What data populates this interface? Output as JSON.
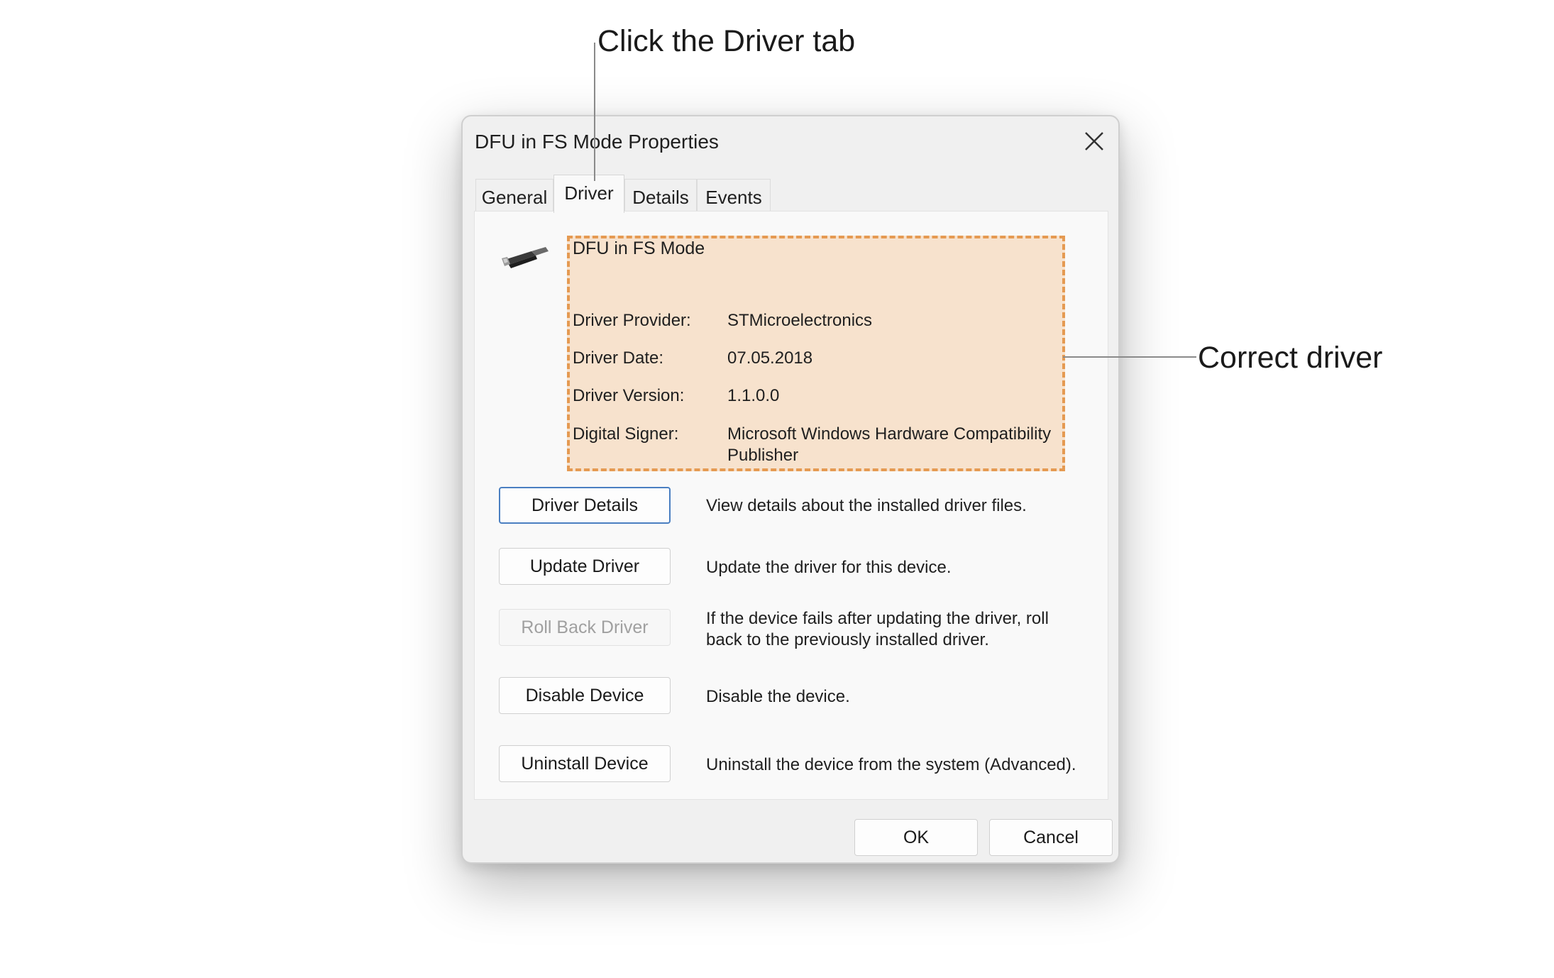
{
  "callouts": {
    "driver_tab": "Click the Driver tab",
    "correct_driver": "Correct driver"
  },
  "dialog": {
    "title": "DFU in FS Mode Properties",
    "close_icon": "close-icon",
    "tabs": [
      {
        "label": "General",
        "active": false
      },
      {
        "label": "Driver",
        "active": true
      },
      {
        "label": "Details",
        "active": false
      },
      {
        "label": "Events",
        "active": false
      }
    ],
    "device_icon": "usb-device-icon",
    "device_name": "DFU in FS Mode",
    "highlight_color": "#e59a52",
    "info": [
      {
        "label": "Driver Provider:",
        "value": "STMicroelectronics"
      },
      {
        "label": "Driver Date:",
        "value": "07.05.2018"
      },
      {
        "label": "Driver Version:",
        "value": "1.1.0.0"
      },
      {
        "label": "Digital Signer:",
        "value": "Microsoft Windows Hardware Compatibility",
        "value_line2": "Publisher"
      }
    ],
    "actions": [
      {
        "label": "Driver Details",
        "description": "View details about the installed driver files.",
        "enabled": true
      },
      {
        "label": "Update Driver",
        "description": "Update the driver for this device.",
        "enabled": true
      },
      {
        "label": "Roll Back Driver",
        "description": "If the device fails after updating the driver, roll",
        "description_line2": "back to the previously installed driver.",
        "enabled": false
      },
      {
        "label": "Disable Device",
        "description": "Disable the device.",
        "enabled": true
      },
      {
        "label": "Uninstall Device",
        "description": "Uninstall the device from the system (Advanced).",
        "enabled": true
      }
    ],
    "ok_label": "OK",
    "cancel_label": "Cancel"
  }
}
